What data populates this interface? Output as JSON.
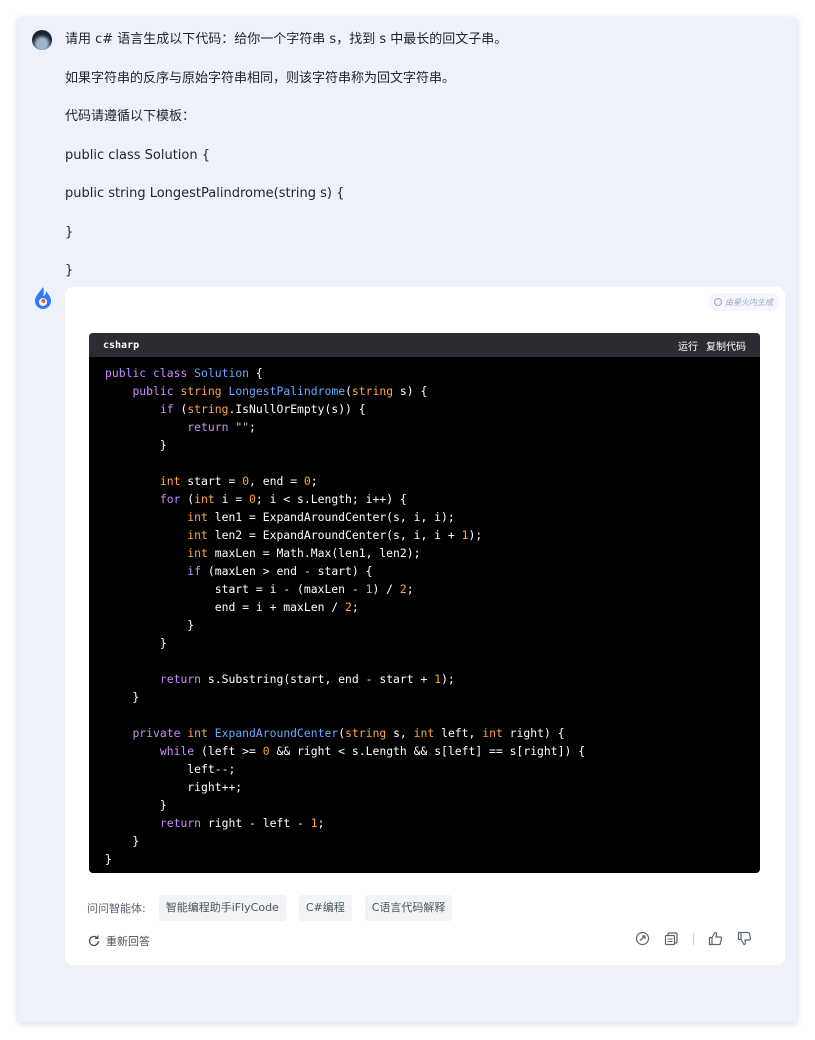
{
  "user": {
    "lines": [
      "请用 c# 语言生成以下代码：给你一个字符串 s，找到 s 中最长的回文子串。",
      "如果字符串的反序与原始字符串相同，则该字符串称为回文字符串。",
      "代码请遵循以下模板：",
      "public class Solution {",
      "public string LongestPalindrome(string s) {",
      "}",
      "}"
    ]
  },
  "answer": {
    "ai_badge": "由星火内生成",
    "code": {
      "language": "csharp",
      "run_label": "运行",
      "copy_label": "复制代码"
    },
    "ask_label": "问问智能体:",
    "agents": [
      "智能编程助手iFlyCode",
      "C#编程",
      "C语言代码解释"
    ],
    "regenerate_label": "重新回答"
  },
  "colors": {
    "frame_bg": "#eef1f9",
    "code_bg": "#000000",
    "keyword": "#c88cff",
    "type": "#ffa640",
    "identifier": "#6aa8ff",
    "string": "#b6d87a"
  },
  "icons": [
    "refresh-icon",
    "share-icon",
    "copy-icon",
    "thumbs-up-icon",
    "thumbs-down-icon"
  ]
}
